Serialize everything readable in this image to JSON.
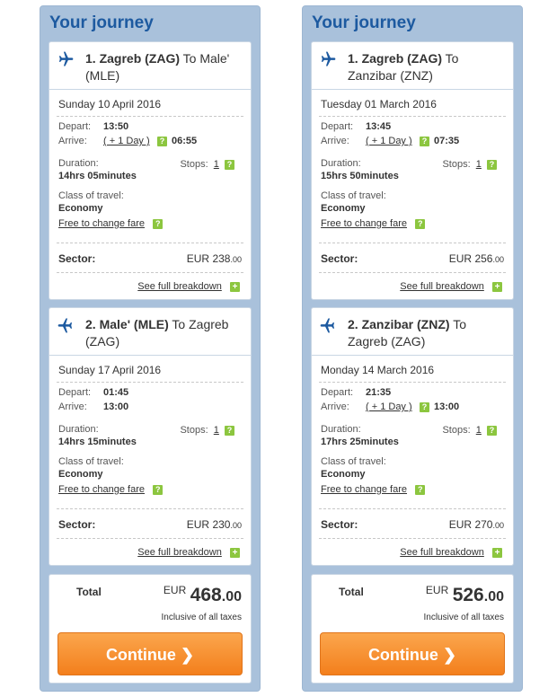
{
  "panels": [
    {
      "title": "Your journey",
      "legs": [
        {
          "route_bold": "1. Zagreb (ZAG)",
          "route_rest": " To Male' (MLE)",
          "date": "Sunday 10 April 2016",
          "depart_label": "Depart:",
          "depart_time": "13:50",
          "arrive_label": "Arrive:",
          "next_day": "( + 1 Day )",
          "arrive_time": "06:55",
          "duration_label": "Duration:",
          "duration": "14hrs 05minutes",
          "stops_label": "Stops:",
          "stops": "1",
          "class_label": "Class of travel:",
          "class": "Economy",
          "fare_link": "Free to change fare",
          "sector_label": "Sector:",
          "sector_currency": "EUR",
          "sector_amount": "238",
          "sector_decimals": ".00",
          "breakdown": "See full breakdown"
        },
        {
          "route_bold": "2. Male' (MLE)",
          "route_rest": " To Zagreb (ZAG)",
          "date": "Sunday 17 April 2016",
          "depart_label": "Depart:",
          "depart_time": "01:45",
          "arrive_label": "Arrive:",
          "next_day": "",
          "arrive_time": "13:00",
          "duration_label": "Duration:",
          "duration": "14hrs 15minutes",
          "stops_label": "Stops:",
          "stops": "1",
          "class_label": "Class of travel:",
          "class": "Economy",
          "fare_link": "Free to change fare",
          "sector_label": "Sector:",
          "sector_currency": "EUR",
          "sector_amount": "230",
          "sector_decimals": ".00",
          "breakdown": "See full breakdown"
        }
      ],
      "total_label": "Total",
      "total_currency": "EUR",
      "total_amount": "468",
      "total_decimals": ".00",
      "inclusive": "Inclusive of all taxes",
      "continue": "Continue"
    },
    {
      "title": "Your journey",
      "legs": [
        {
          "route_bold": "1. Zagreb (ZAG)",
          "route_rest": " To Zanzibar (ZNZ)",
          "date": "Tuesday 01 March 2016",
          "depart_label": "Depart:",
          "depart_time": "13:45",
          "arrive_label": "Arrive:",
          "next_day": "( + 1 Day )",
          "arrive_time": "07:35",
          "duration_label": "Duration:",
          "duration": "15hrs 50minutes",
          "stops_label": "Stops:",
          "stops": "1",
          "class_label": "Class of travel:",
          "class": "Economy",
          "fare_link": "Free to change fare",
          "sector_label": "Sector:",
          "sector_currency": "EUR",
          "sector_amount": "256",
          "sector_decimals": ".00",
          "breakdown": "See full breakdown"
        },
        {
          "route_bold": "2. Zanzibar (ZNZ)",
          "route_rest": " To Zagreb (ZAG)",
          "date": "Monday 14 March 2016",
          "depart_label": "Depart:",
          "depart_time": "21:35",
          "arrive_label": "Arrive:",
          "next_day": "( + 1 Day )",
          "arrive_time": "13:00",
          "duration_label": "Duration:",
          "duration": "17hrs 25minutes",
          "stops_label": "Stops:",
          "stops": "1",
          "class_label": "Class of travel:",
          "class": "Economy",
          "fare_link": "Free to change fare",
          "sector_label": "Sector:",
          "sector_currency": "EUR",
          "sector_amount": "270",
          "sector_decimals": ".00",
          "breakdown": "See full breakdown"
        }
      ],
      "total_label": "Total",
      "total_currency": "EUR",
      "total_amount": "526",
      "total_decimals": ".00",
      "inclusive": "Inclusive of all taxes",
      "continue": "Continue"
    }
  ],
  "colors": {
    "panel_bg": "#a9c1db",
    "title": "#1d5aa0",
    "help_badge": "#8cc63f",
    "continue_button": "#f5891f"
  }
}
